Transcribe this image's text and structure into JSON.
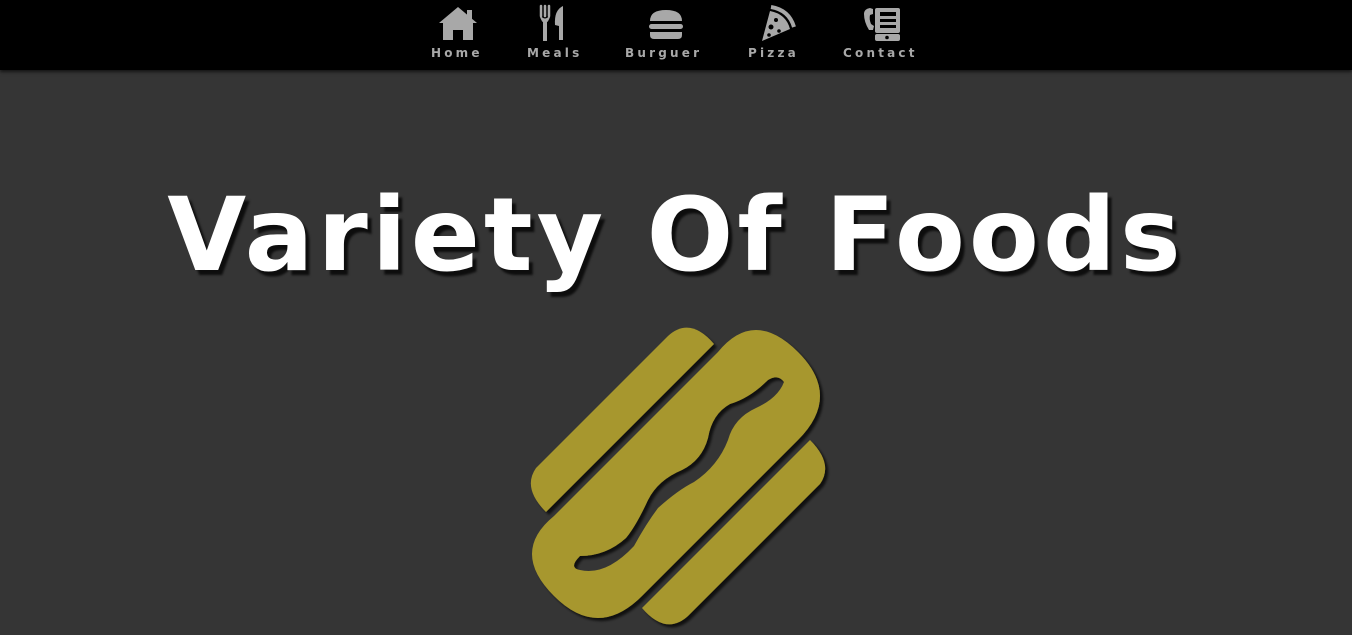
{
  "nav": {
    "items": [
      {
        "label": "Home",
        "icon": "home-icon"
      },
      {
        "label": "Meals",
        "icon": "utensils-icon"
      },
      {
        "label": "Burguer",
        "icon": "burger-icon"
      },
      {
        "label": "Pizza",
        "icon": "pizza-slice-icon"
      },
      {
        "label": "Contact",
        "icon": "phone-icon"
      }
    ]
  },
  "hero": {
    "title": "Variety Of Foods",
    "logo_icon": "hotdog-icon"
  },
  "colors": {
    "navbar_bg": "#000000",
    "page_bg": "#353535",
    "nav_text": "#a8a8a8",
    "title_text": "#ffffff",
    "logo_fill": "#a7972e"
  }
}
